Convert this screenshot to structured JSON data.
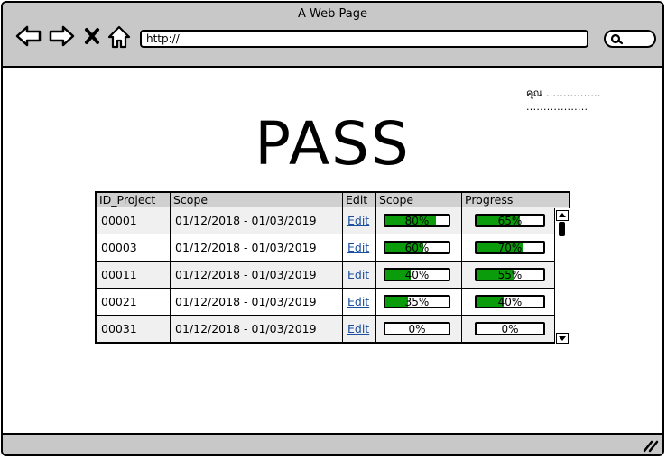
{
  "browser": {
    "title": "A Web Page",
    "url": "http://"
  },
  "header": {
    "user_label": "คุณ ................  ..................",
    "page_title": "PASS"
  },
  "table": {
    "columns": [
      "ID_Project",
      "Scope",
      "Edit",
      "Scope",
      "Progress"
    ],
    "rows": [
      {
        "id": "00001",
        "scope": "01/12/2018 - 01/03/2019",
        "edit": "Edit",
        "scope_pct": 80,
        "scope_label": "80%",
        "progress_pct": 65,
        "progress_label": "65%"
      },
      {
        "id": "00003",
        "scope": "01/12/2018 - 01/03/2019",
        "edit": "Edit",
        "scope_pct": 60,
        "scope_label": "60%",
        "progress_pct": 70,
        "progress_label": "70%"
      },
      {
        "id": "00011",
        "scope": "01/12/2018 - 01/03/2019",
        "edit": "Edit",
        "scope_pct": 40,
        "scope_label": "40%",
        "progress_pct": 55,
        "progress_label": "55%"
      },
      {
        "id": "00021",
        "scope": "01/12/2018 - 01/03/2019",
        "edit": "Edit",
        "scope_pct": 35,
        "scope_label": "35%",
        "progress_pct": 40,
        "progress_label": "40%"
      },
      {
        "id": "00031",
        "scope": "01/12/2018 - 01/03/2019",
        "edit": "Edit",
        "scope_pct": 0,
        "scope_label": "0%",
        "progress_pct": 0,
        "progress_label": "0%"
      }
    ]
  },
  "icons": {
    "back": "arrow-left-icon",
    "forward": "arrow-right-icon",
    "stop": "close-icon",
    "home": "home-icon",
    "search": "search-icon",
    "resize": "resize-grip-icon"
  },
  "colors": {
    "progress_fill": "#0a9c0a",
    "chrome": "#c8c8c8",
    "link": "#1a4fa0"
  }
}
